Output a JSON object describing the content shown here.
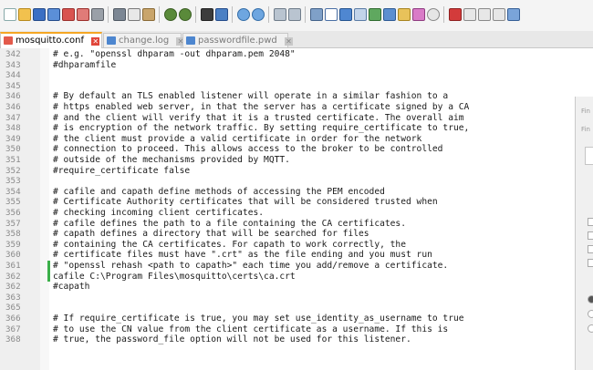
{
  "tabs": [
    {
      "label": "mosquitto.conf",
      "active": true
    },
    {
      "label": "change.log",
      "active": false
    },
    {
      "label": "passwordfile.pwd",
      "active": false
    }
  ],
  "editor": {
    "lines": [
      {
        "n": "342",
        "text": "# e.g. \"openssl dhparam -out dhparam.pem 2048\""
      },
      {
        "n": "343",
        "text": "#dhparamfile"
      },
      {
        "n": "344",
        "text": ""
      },
      {
        "n": "345",
        "text": ""
      },
      {
        "n": "346",
        "text": "# By default an TLS enabled listener will operate in a similar fashion to a"
      },
      {
        "n": "346",
        "text": "# https enabled web server, in that the server has a certificate signed by a CA"
      },
      {
        "n": "347",
        "text": "# and the client will verify that it is a trusted certificate. The overall aim"
      },
      {
        "n": "348",
        "text": "# is encryption of the network traffic. By setting require_certificate to true,"
      },
      {
        "n": "349",
        "text": "# the client must provide a valid certificate in order for the network"
      },
      {
        "n": "350",
        "text": "# connection to proceed. This allows access to the broker to be controlled"
      },
      {
        "n": "351",
        "text": "# outside of the mechanisms provided by MQTT."
      },
      {
        "n": "352",
        "text": "#require_certificate false"
      },
      {
        "n": "353",
        "text": ""
      },
      {
        "n": "354",
        "text": "# cafile and capath define methods of accessing the PEM encoded"
      },
      {
        "n": "355",
        "text": "# Certificate Authority certificates that will be considered trusted when"
      },
      {
        "n": "356",
        "text": "# checking incoming client certificates."
      },
      {
        "n": "357",
        "text": "# cafile defines the path to a file containing the CA certificates."
      },
      {
        "n": "358",
        "text": "# capath defines a directory that will be searched for files"
      },
      {
        "n": "359",
        "text": "# containing the CA certificates. For capath to work correctly, the"
      },
      {
        "n": "360",
        "text": "# certificate files must have \".crt\" as the file ending and you must run"
      },
      {
        "n": "361",
        "text": "# \"openssl rehash <path to capath>\" each time you add/remove a certificate."
      },
      {
        "n": "362",
        "text": "cafile C:\\Program Files\\mosquitto\\certs\\ca.crt"
      },
      {
        "n": "362",
        "text": "#capath"
      },
      {
        "n": "363",
        "text": ""
      },
      {
        "n": "365",
        "text": ""
      },
      {
        "n": "366",
        "text": "# If require_certificate is true, you may set use_identity_as_username to true"
      },
      {
        "n": "367",
        "text": "# to use the CN value from the client certificate as a username. If this is"
      },
      {
        "n": "368",
        "text": "# true, the password_file option will not be used for this listener."
      }
    ]
  },
  "find_dialog": {
    "title_partial": "Fin",
    "field_label_partial": "Fin"
  },
  "colors": {
    "active_tab_accent": "#f5a623",
    "changed_line_marker": "#3bb04a",
    "gutter_bg": "#efefef"
  }
}
